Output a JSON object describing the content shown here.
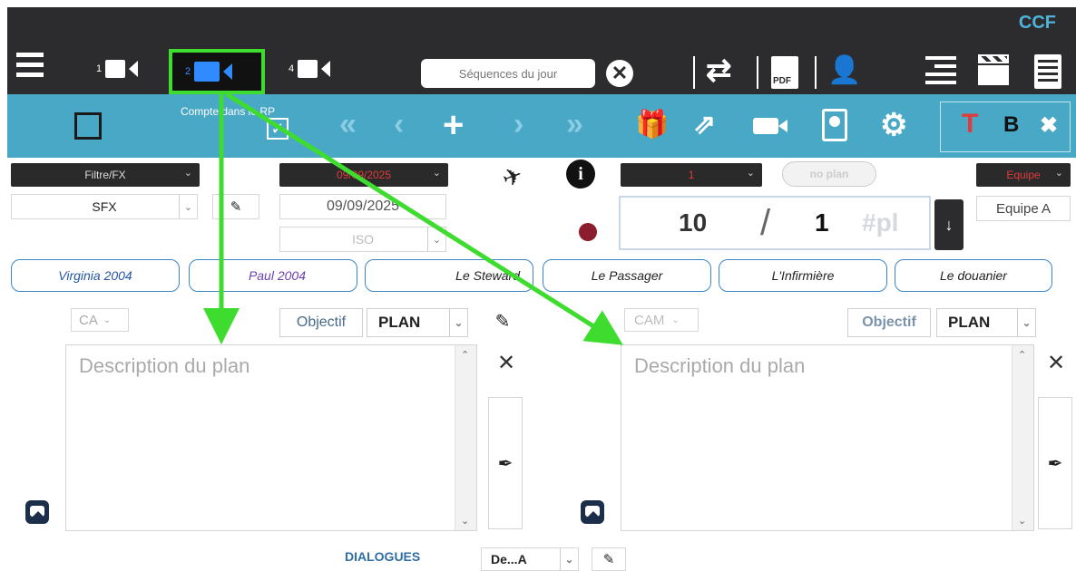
{
  "app": {
    "brand": "CCF"
  },
  "topbar": {
    "cameras": [
      {
        "number": "1",
        "active": false
      },
      {
        "number": "2",
        "active": true
      },
      {
        "number": "4",
        "active": false
      }
    ],
    "search": {
      "placeholder": "Séquences du jour"
    },
    "icons": [
      "menu-icon",
      "camera-icon",
      "clear-icon",
      "swap-icon",
      "pdf-icon",
      "user-settings-icon",
      "list-icon",
      "clapperboard-icon",
      "document-icon"
    ],
    "pdf_label": "PDF"
  },
  "toolbar": {
    "compte_label": "Compte dans le RP",
    "format_bold": "B",
    "format_text": "T",
    "icons": [
      "checkbox-icon",
      "check-square-icon",
      "double-left-icon",
      "left-icon",
      "plus-icon",
      "right-icon",
      "double-right-icon",
      "gift-icon",
      "share-icon",
      "camera-icon",
      "badge-icon",
      "gear-icon",
      "text-color-icon",
      "bold-icon",
      "close-icon"
    ]
  },
  "filters": {
    "filter_fx": "Filtre/FX",
    "sfx": "SFX",
    "date_red": "09/09/2025",
    "date": "09/09/2025",
    "iso": "ISO",
    "scene_select": "1",
    "no_plan": "no plan",
    "equipe_select": "Equipe",
    "equipe_value": "Equipe A",
    "plan_counter": {
      "current": "10",
      "separator": "/",
      "total": "1",
      "suffix": "#pl"
    }
  },
  "characters": [
    "Virginia 2004",
    "Paul 2004",
    "Le Steward",
    "Le Passager",
    "L'Infirmière",
    "Le douanier"
  ],
  "colors": {
    "topbar": "#2c2c2e",
    "toolbar": "#4aa8c7",
    "highlight": "#3ddc2f",
    "active_camera": "#2f8bff",
    "red_text": "#e23b3b",
    "pill_border": "#3a86c4"
  },
  "panels": [
    {
      "cam": "CA",
      "objectif": "Objectif",
      "plan": "PLAN",
      "placeholder": "Description du plan"
    },
    {
      "cam": "CAM",
      "objectif": "Objectif",
      "plan": "PLAN",
      "placeholder": "Description du plan"
    }
  ],
  "dialogues": {
    "label": "DIALOGUES",
    "select": "De...A"
  }
}
